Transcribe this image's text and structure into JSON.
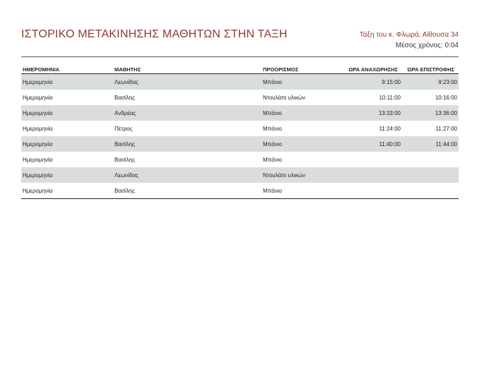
{
  "header": {
    "title": "ΙΣΤΟΡΙΚΟ ΜΕΤΑΚΙΝΗΣΗΣ ΜΑΘΗΤΩΝ ΣΤΗΝ ΤΑΞΗ",
    "class_info": "Τάξη του κ. Φλωρά, Αίθουσα 34",
    "avg_label": "Μέσος χρόνος:",
    "avg_value": "0:04"
  },
  "table": {
    "columns": [
      "ΗΜΕΡΟΜΗΝΙΑ",
      "ΜΑΘΗΤΗΣ",
      "ΠΡΟΟΡΙΣΜΟΣ",
      "ΩΡΑ ΑΝΑΧΩΡΗΣΗΣ",
      "ΏΡΑ ΕΠΙΣΤΡΟΦΗΣ"
    ],
    "rows": [
      {
        "date": "Ημερομηνία",
        "student": "Λεωνίδας",
        "destination": "Μπάνιο",
        "departure": "9:15:00",
        "return": "9:23:00"
      },
      {
        "date": "Ημερομηνία",
        "student": "Βασίλης",
        "destination": "Ντουλάπι υλικών",
        "departure": "10:11:00",
        "return": "10:16:00"
      },
      {
        "date": "Ημερομηνία",
        "student": "Ανδρέας",
        "destination": "Μπάνιο",
        "departure": "13:33:00",
        "return": "13:36:00"
      },
      {
        "date": "Ημερομηνία",
        "student": "Πέτρος",
        "destination": "Μπάνιο",
        "departure": "11:24:00",
        "return": "11:27:00"
      },
      {
        "date": "Ημερομηνία",
        "student": "Βασίλης",
        "destination": "Μπάνιο",
        "departure": "11:40:00",
        "return": "11:44:00"
      },
      {
        "date": "Ημερομηνία",
        "student": "Βασίλης",
        "destination": "Μπάνιο",
        "departure": "",
        "return": ""
      },
      {
        "date": "Ημερομηνία",
        "student": "Λεωνίδας",
        "destination": "Ντουλάπι υλικών",
        "departure": "",
        "return": ""
      },
      {
        "date": "Ημερομηνία",
        "student": "Βασίλης",
        "destination": "Μπάνιο",
        "departure": "",
        "return": ""
      }
    ]
  }
}
